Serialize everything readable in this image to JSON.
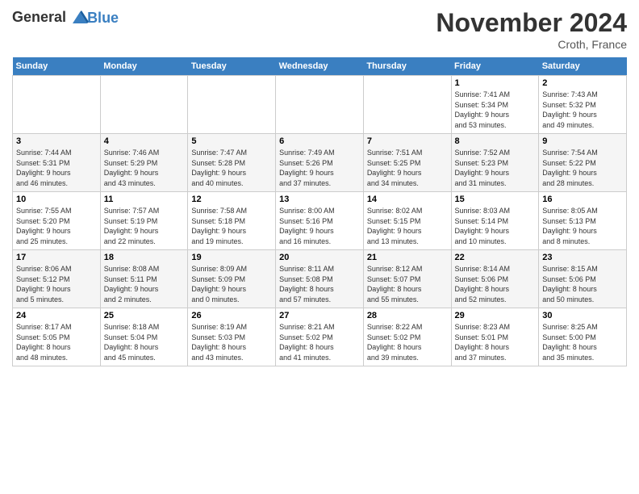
{
  "header": {
    "logo_line1": "General",
    "logo_line2": "Blue",
    "month": "November 2024",
    "location": "Croth, France"
  },
  "weekdays": [
    "Sunday",
    "Monday",
    "Tuesday",
    "Wednesday",
    "Thursday",
    "Friday",
    "Saturday"
  ],
  "weeks": [
    [
      {
        "day": "",
        "info": ""
      },
      {
        "day": "",
        "info": ""
      },
      {
        "day": "",
        "info": ""
      },
      {
        "day": "",
        "info": ""
      },
      {
        "day": "",
        "info": ""
      },
      {
        "day": "1",
        "info": "Sunrise: 7:41 AM\nSunset: 5:34 PM\nDaylight: 9 hours\nand 53 minutes."
      },
      {
        "day": "2",
        "info": "Sunrise: 7:43 AM\nSunset: 5:32 PM\nDaylight: 9 hours\nand 49 minutes."
      }
    ],
    [
      {
        "day": "3",
        "info": "Sunrise: 7:44 AM\nSunset: 5:31 PM\nDaylight: 9 hours\nand 46 minutes."
      },
      {
        "day": "4",
        "info": "Sunrise: 7:46 AM\nSunset: 5:29 PM\nDaylight: 9 hours\nand 43 minutes."
      },
      {
        "day": "5",
        "info": "Sunrise: 7:47 AM\nSunset: 5:28 PM\nDaylight: 9 hours\nand 40 minutes."
      },
      {
        "day": "6",
        "info": "Sunrise: 7:49 AM\nSunset: 5:26 PM\nDaylight: 9 hours\nand 37 minutes."
      },
      {
        "day": "7",
        "info": "Sunrise: 7:51 AM\nSunset: 5:25 PM\nDaylight: 9 hours\nand 34 minutes."
      },
      {
        "day": "8",
        "info": "Sunrise: 7:52 AM\nSunset: 5:23 PM\nDaylight: 9 hours\nand 31 minutes."
      },
      {
        "day": "9",
        "info": "Sunrise: 7:54 AM\nSunset: 5:22 PM\nDaylight: 9 hours\nand 28 minutes."
      }
    ],
    [
      {
        "day": "10",
        "info": "Sunrise: 7:55 AM\nSunset: 5:20 PM\nDaylight: 9 hours\nand 25 minutes."
      },
      {
        "day": "11",
        "info": "Sunrise: 7:57 AM\nSunset: 5:19 PM\nDaylight: 9 hours\nand 22 minutes."
      },
      {
        "day": "12",
        "info": "Sunrise: 7:58 AM\nSunset: 5:18 PM\nDaylight: 9 hours\nand 19 minutes."
      },
      {
        "day": "13",
        "info": "Sunrise: 8:00 AM\nSunset: 5:16 PM\nDaylight: 9 hours\nand 16 minutes."
      },
      {
        "day": "14",
        "info": "Sunrise: 8:02 AM\nSunset: 5:15 PM\nDaylight: 9 hours\nand 13 minutes."
      },
      {
        "day": "15",
        "info": "Sunrise: 8:03 AM\nSunset: 5:14 PM\nDaylight: 9 hours\nand 10 minutes."
      },
      {
        "day": "16",
        "info": "Sunrise: 8:05 AM\nSunset: 5:13 PM\nDaylight: 9 hours\nand 8 minutes."
      }
    ],
    [
      {
        "day": "17",
        "info": "Sunrise: 8:06 AM\nSunset: 5:12 PM\nDaylight: 9 hours\nand 5 minutes."
      },
      {
        "day": "18",
        "info": "Sunrise: 8:08 AM\nSunset: 5:11 PM\nDaylight: 9 hours\nand 2 minutes."
      },
      {
        "day": "19",
        "info": "Sunrise: 8:09 AM\nSunset: 5:09 PM\nDaylight: 9 hours\nand 0 minutes."
      },
      {
        "day": "20",
        "info": "Sunrise: 8:11 AM\nSunset: 5:08 PM\nDaylight: 8 hours\nand 57 minutes."
      },
      {
        "day": "21",
        "info": "Sunrise: 8:12 AM\nSunset: 5:07 PM\nDaylight: 8 hours\nand 55 minutes."
      },
      {
        "day": "22",
        "info": "Sunrise: 8:14 AM\nSunset: 5:06 PM\nDaylight: 8 hours\nand 52 minutes."
      },
      {
        "day": "23",
        "info": "Sunrise: 8:15 AM\nSunset: 5:06 PM\nDaylight: 8 hours\nand 50 minutes."
      }
    ],
    [
      {
        "day": "24",
        "info": "Sunrise: 8:17 AM\nSunset: 5:05 PM\nDaylight: 8 hours\nand 48 minutes."
      },
      {
        "day": "25",
        "info": "Sunrise: 8:18 AM\nSunset: 5:04 PM\nDaylight: 8 hours\nand 45 minutes."
      },
      {
        "day": "26",
        "info": "Sunrise: 8:19 AM\nSunset: 5:03 PM\nDaylight: 8 hours\nand 43 minutes."
      },
      {
        "day": "27",
        "info": "Sunrise: 8:21 AM\nSunset: 5:02 PM\nDaylight: 8 hours\nand 41 minutes."
      },
      {
        "day": "28",
        "info": "Sunrise: 8:22 AM\nSunset: 5:02 PM\nDaylight: 8 hours\nand 39 minutes."
      },
      {
        "day": "29",
        "info": "Sunrise: 8:23 AM\nSunset: 5:01 PM\nDaylight: 8 hours\nand 37 minutes."
      },
      {
        "day": "30",
        "info": "Sunrise: 8:25 AM\nSunset: 5:00 PM\nDaylight: 8 hours\nand 35 minutes."
      }
    ]
  ]
}
